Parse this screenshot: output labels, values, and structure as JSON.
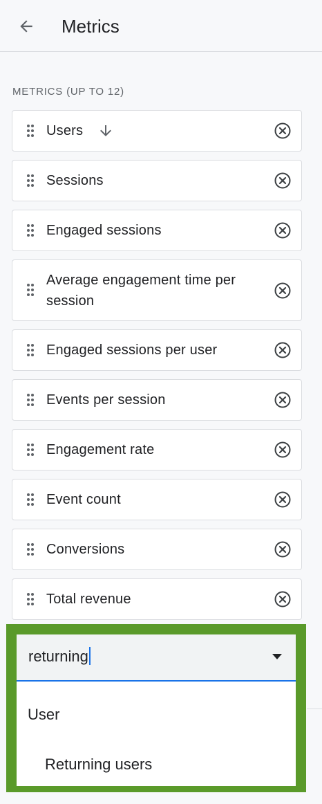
{
  "header": {
    "title": "Metrics",
    "back_icon": "arrow-back-icon"
  },
  "section": {
    "label": "METRICS (UP TO 12)"
  },
  "metrics": [
    {
      "label": "Users",
      "sorted": "descending"
    },
    {
      "label": "Sessions"
    },
    {
      "label": "Engaged sessions"
    },
    {
      "label": "Average engagement time per session"
    },
    {
      "label": "Engaged sessions per user"
    },
    {
      "label": "Events per session"
    },
    {
      "label": "Engagement rate"
    },
    {
      "label": "Event count"
    },
    {
      "label": "Conversions"
    },
    {
      "label": "Total revenue"
    }
  ],
  "search": {
    "value": "returning"
  },
  "dropdown": {
    "group_label": "User",
    "options": [
      "Returning users"
    ]
  },
  "colors": {
    "highlight_border": "#5a9a2a",
    "input_underline": "#1a73e8",
    "chip_border": "#dadce0",
    "background": "#f7f8fa"
  }
}
